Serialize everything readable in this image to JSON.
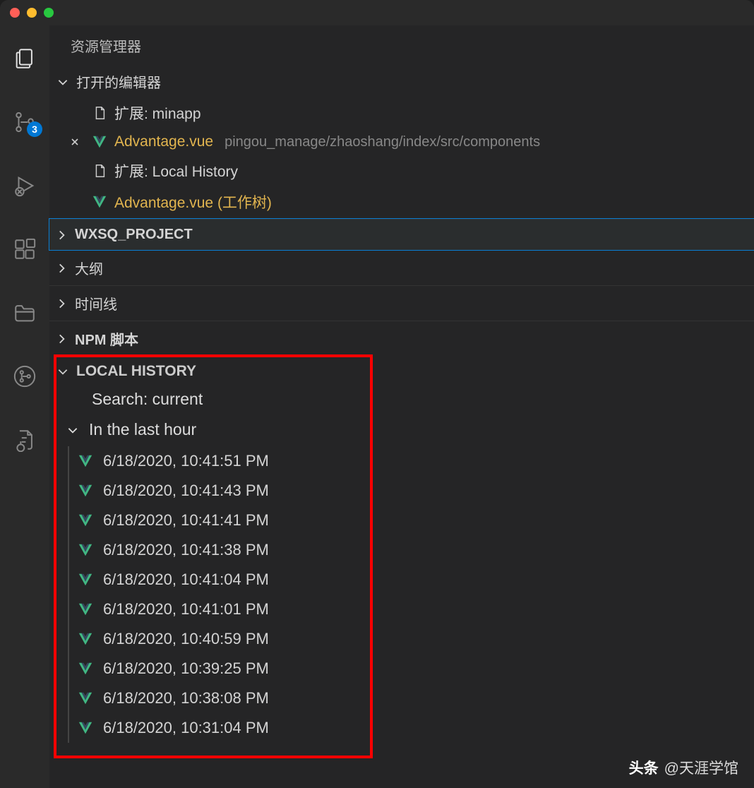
{
  "sidebar": {
    "title": "资源管理器"
  },
  "openEditors": {
    "title": "打开的编辑器",
    "items": [
      {
        "name": "扩展: minapp",
        "modified": false,
        "icon": "file"
      },
      {
        "name": "Advantage.vue",
        "path": "pingou_manage/zhaoshang/index/src/components",
        "modified": true,
        "icon": "vue",
        "closeable": true
      },
      {
        "name": "扩展: Local History",
        "modified": false,
        "icon": "file"
      },
      {
        "name": "Advantage.vue (工作树)",
        "modified": true,
        "icon": "vue"
      }
    ]
  },
  "sections": [
    {
      "label": "WXSQ_PROJECT",
      "bold": true,
      "selected": true
    },
    {
      "label": "大纲",
      "bold": false
    },
    {
      "label": "时间线",
      "bold": false
    },
    {
      "label": "NPM 脚本",
      "bold": true
    }
  ],
  "localHistory": {
    "title": "LOCAL HISTORY",
    "search": "Search: current",
    "group": "In the last hour",
    "entries": [
      "6/18/2020, 10:41:51 PM",
      "6/18/2020, 10:41:43 PM",
      "6/18/2020, 10:41:41 PM",
      "6/18/2020, 10:41:38 PM",
      "6/18/2020, 10:41:04 PM",
      "6/18/2020, 10:41:01 PM",
      "6/18/2020, 10:40:59 PM",
      "6/18/2020, 10:39:25 PM",
      "6/18/2020, 10:38:08 PM",
      "6/18/2020, 10:31:04 PM"
    ]
  },
  "activityBar": {
    "badge": "3"
  },
  "watermark": {
    "brand": "头条",
    "text": "@天涯学馆"
  }
}
